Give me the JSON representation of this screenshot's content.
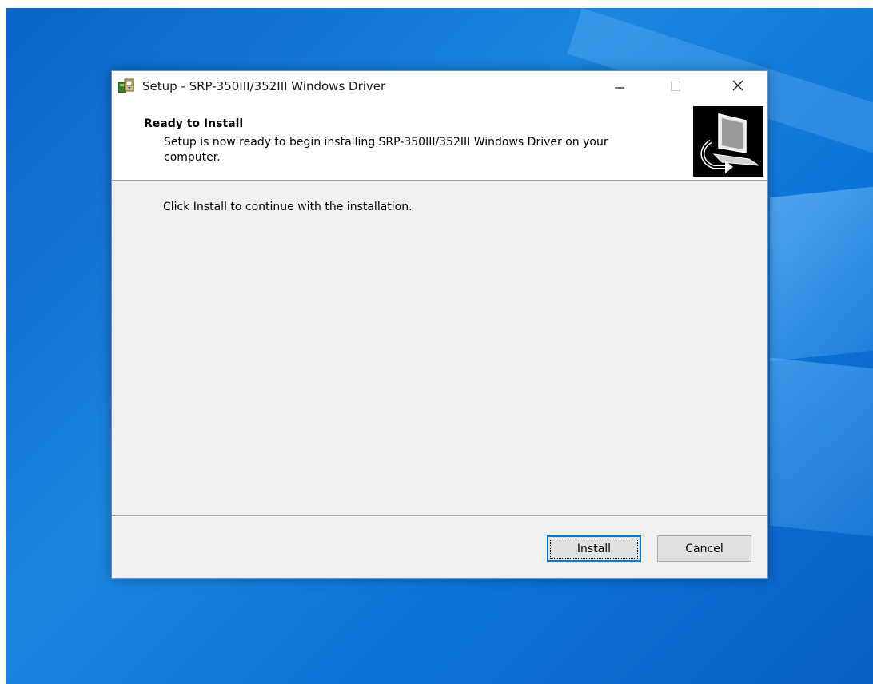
{
  "window": {
    "title": "Setup - SRP-350III/352III Windows Driver",
    "app_icon": "setup-installer-icon",
    "controls": {
      "minimize": "minimize-icon",
      "maximize": "maximize-icon",
      "close": "close-icon"
    }
  },
  "header": {
    "title": "Ready to Install",
    "subtitle": "Setup is now ready to begin installing SRP-350III/352III Windows Driver on your computer.",
    "image": "computer-install-icon"
  },
  "body": {
    "message": "Click Install to continue with the installation."
  },
  "buttons": {
    "install_label": "Install",
    "cancel_label": "Cancel"
  },
  "colors": {
    "desktop": "#0b72d6",
    "dialog_bg": "#f0f0f0",
    "focus_border": "#0078d7"
  }
}
